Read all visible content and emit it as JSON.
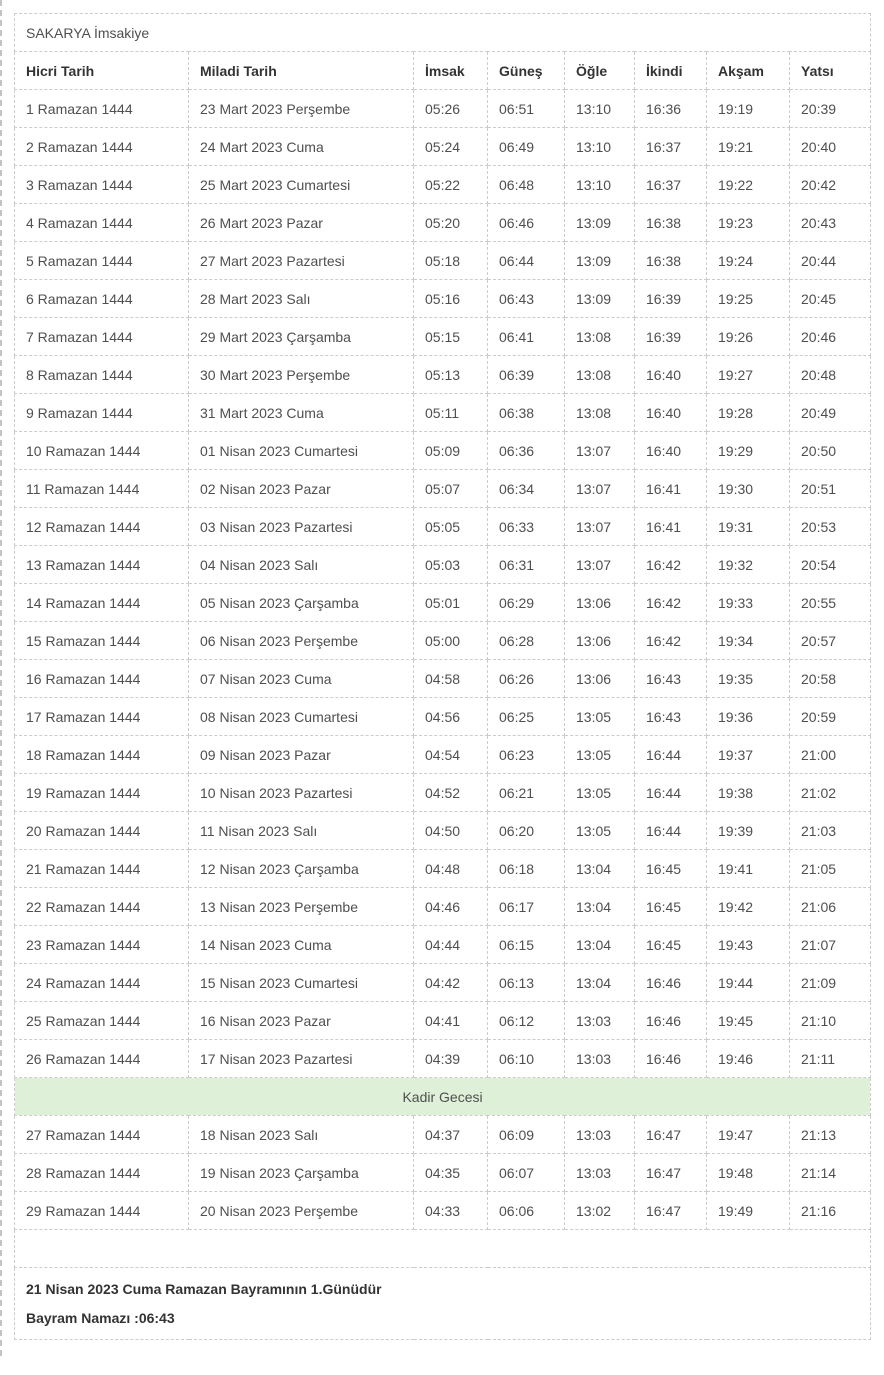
{
  "title": "SAKARYA İmsakiye",
  "table": {
    "headers": [
      "Hicri Tarih",
      "Miladi Tarih",
      "İmsak",
      "Güneş",
      "Öğle",
      "İkindi",
      "Akşam",
      "Yatsı"
    ],
    "rows": [
      [
        "1 Ramazan 1444",
        "23 Mart 2023 Perşembe",
        "05:26",
        "06:51",
        "13:10",
        "16:36",
        "19:19",
        "20:39"
      ],
      [
        "2 Ramazan 1444",
        "24 Mart 2023 Cuma",
        "05:24",
        "06:49",
        "13:10",
        "16:37",
        "19:21",
        "20:40"
      ],
      [
        "3 Ramazan 1444",
        "25 Mart 2023 Cumartesi",
        "05:22",
        "06:48",
        "13:10",
        "16:37",
        "19:22",
        "20:42"
      ],
      [
        "4 Ramazan 1444",
        "26 Mart 2023 Pazar",
        "05:20",
        "06:46",
        "13:09",
        "16:38",
        "19:23",
        "20:43"
      ],
      [
        "5 Ramazan 1444",
        "27 Mart 2023 Pazartesi",
        "05:18",
        "06:44",
        "13:09",
        "16:38",
        "19:24",
        "20:44"
      ],
      [
        "6 Ramazan 1444",
        "28 Mart 2023 Salı",
        "05:16",
        "06:43",
        "13:09",
        "16:39",
        "19:25",
        "20:45"
      ],
      [
        "7 Ramazan 1444",
        "29 Mart 2023 Çarşamba",
        "05:15",
        "06:41",
        "13:08",
        "16:39",
        "19:26",
        "20:46"
      ],
      [
        "8 Ramazan 1444",
        "30 Mart 2023 Perşembe",
        "05:13",
        "06:39",
        "13:08",
        "16:40",
        "19:27",
        "20:48"
      ],
      [
        "9 Ramazan 1444",
        "31 Mart 2023 Cuma",
        "05:11",
        "06:38",
        "13:08",
        "16:40",
        "19:28",
        "20:49"
      ],
      [
        "10 Ramazan 1444",
        "01 Nisan 2023 Cumartesi",
        "05:09",
        "06:36",
        "13:07",
        "16:40",
        "19:29",
        "20:50"
      ],
      [
        "11 Ramazan 1444",
        "02 Nisan 2023 Pazar",
        "05:07",
        "06:34",
        "13:07",
        "16:41",
        "19:30",
        "20:51"
      ],
      [
        "12 Ramazan 1444",
        "03 Nisan 2023 Pazartesi",
        "05:05",
        "06:33",
        "13:07",
        "16:41",
        "19:31",
        "20:53"
      ],
      [
        "13 Ramazan 1444",
        "04 Nisan 2023 Salı",
        "05:03",
        "06:31",
        "13:07",
        "16:42",
        "19:32",
        "20:54"
      ],
      [
        "14 Ramazan 1444",
        "05 Nisan 2023 Çarşamba",
        "05:01",
        "06:29",
        "13:06",
        "16:42",
        "19:33",
        "20:55"
      ],
      [
        "15 Ramazan 1444",
        "06 Nisan 2023 Perşembe",
        "05:00",
        "06:28",
        "13:06",
        "16:42",
        "19:34",
        "20:57"
      ],
      [
        "16 Ramazan 1444",
        "07 Nisan 2023 Cuma",
        "04:58",
        "06:26",
        "13:06",
        "16:43",
        "19:35",
        "20:58"
      ],
      [
        "17 Ramazan 1444",
        "08 Nisan 2023 Cumartesi",
        "04:56",
        "06:25",
        "13:05",
        "16:43",
        "19:36",
        "20:59"
      ],
      [
        "18 Ramazan 1444",
        "09 Nisan 2023 Pazar",
        "04:54",
        "06:23",
        "13:05",
        "16:44",
        "19:37",
        "21:00"
      ],
      [
        "19 Ramazan 1444",
        "10 Nisan 2023 Pazartesi",
        "04:52",
        "06:21",
        "13:05",
        "16:44",
        "19:38",
        "21:02"
      ],
      [
        "20 Ramazan 1444",
        "11 Nisan 2023 Salı",
        "04:50",
        "06:20",
        "13:05",
        "16:44",
        "19:39",
        "21:03"
      ],
      [
        "21 Ramazan 1444",
        "12 Nisan 2023 Çarşamba",
        "04:48",
        "06:18",
        "13:04",
        "16:45",
        "19:41",
        "21:05"
      ],
      [
        "22 Ramazan 1444",
        "13 Nisan 2023 Perşembe",
        "04:46",
        "06:17",
        "13:04",
        "16:45",
        "19:42",
        "21:06"
      ],
      [
        "23 Ramazan 1444",
        "14 Nisan 2023 Cuma",
        "04:44",
        "06:15",
        "13:04",
        "16:45",
        "19:43",
        "21:07"
      ],
      [
        "24 Ramazan 1444",
        "15 Nisan 2023 Cumartesi",
        "04:42",
        "06:13",
        "13:04",
        "16:46",
        "19:44",
        "21:09"
      ],
      [
        "25 Ramazan 1444",
        "16 Nisan 2023 Pazar",
        "04:41",
        "06:12",
        "13:03",
        "16:46",
        "19:45",
        "21:10"
      ],
      [
        "26 Ramazan 1444",
        "17 Nisan 2023 Pazartesi",
        "04:39",
        "06:10",
        "13:03",
        "16:46",
        "19:46",
        "21:11"
      ],
      [
        "27 Ramazan 1444",
        "18 Nisan 2023 Salı",
        "04:37",
        "06:09",
        "13:03",
        "16:47",
        "19:47",
        "21:13"
      ],
      [
        "28 Ramazan 1444",
        "19 Nisan 2023 Çarşamba",
        "04:35",
        "06:07",
        "13:03",
        "16:47",
        "19:48",
        "21:14"
      ],
      [
        "29 Ramazan 1444",
        "20 Nisan 2023 Perşembe",
        "04:33",
        "06:06",
        "13:02",
        "16:47",
        "19:49",
        "21:16"
      ]
    ],
    "kadir_row": {
      "label": "Kadir Gecesi",
      "insert_after": 26
    }
  },
  "footer": {
    "bayram_line": "21 Nisan 2023 Cuma Ramazan Bayramının 1.Günüdür",
    "namaz_line": "Bayram Namazı :06:43"
  },
  "colors": {
    "kadir_background": "#dff0d8",
    "border": "#cccccc",
    "body_text": "#4f4f4f",
    "header_text": "#333333"
  }
}
